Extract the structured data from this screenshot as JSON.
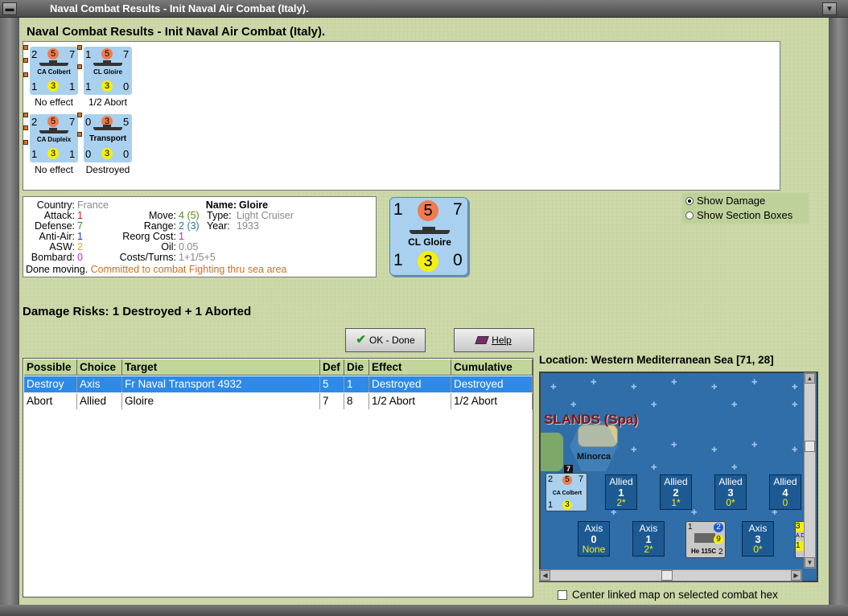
{
  "window": {
    "title": "Naval Combat Results - Init Naval Air Combat (Italy)."
  },
  "heading": "Naval Combat Results - Init Naval Air Combat (Italy).",
  "results": [
    {
      "name": "CA Colbert",
      "left": "2",
      "att": "5",
      "right": "7",
      "bl": "1",
      "def": "3",
      "br": "1",
      "effect": "No effect"
    },
    {
      "name": "CL Gloire",
      "left": "1",
      "att": "5",
      "right": "7",
      "bl": "1",
      "def": "3",
      "br": "0",
      "effect": "1/2 Abort"
    },
    {
      "name": "CA Dupleix",
      "left": "2",
      "att": "5",
      "right": "7",
      "bl": "1",
      "def": "3",
      "br": "1",
      "effect": "No effect"
    },
    {
      "name": "Transport",
      "left": "0",
      "att": "3",
      "right": "5",
      "bl": "0",
      "def": "3",
      "br": "0",
      "effect": "Destroyed"
    }
  ],
  "info": {
    "country_label": "Country:",
    "country": "France",
    "attack_label": "Attack:",
    "attack": "1",
    "defense_label": "Defense:",
    "defense": "7",
    "antiair_label": "Anti-Air:",
    "antiair": "1",
    "asw_label": "ASW:",
    "asw": "2",
    "bombard_label": "Bombard:",
    "bombard": "0",
    "name_label": "Name:",
    "name": "Gloire",
    "move_label": "Move:",
    "move": "4",
    "move_paren": "(5)",
    "type_label": "Type:",
    "type": "Light Cruiser",
    "range_label": "Range:",
    "range": "2",
    "range_paren": "(3)",
    "year_label": "Year:",
    "year": "1933",
    "reorg_label": "Reorg Cost:",
    "reorg": "1",
    "oil_label": "Oil:",
    "oil": "0.05",
    "costs_label": "Costs/Turns:",
    "costs": "1+1/5+5",
    "status": "Done moving.",
    "status_detail": "Committed to combat Fighting thru sea area"
  },
  "big_counter": {
    "name": "CL Gloire",
    "left": "1",
    "att": "5",
    "right": "7",
    "bl": "1",
    "def": "3",
    "br": "0"
  },
  "display_options": {
    "show_damage": "Show Damage",
    "show_section": "Show Section Boxes"
  },
  "damage_risks": "Damage Risks:  1 Destroyed + 1 Aborted",
  "buttons": {
    "ok": "OK - Done",
    "help": "Help"
  },
  "table": {
    "headers": [
      "Possible",
      "Choice",
      "Target",
      "Def",
      "Die",
      "Effect",
      "Cumulative"
    ],
    "rows": [
      [
        "Destroy",
        "Axis",
        "Fr Naval Transport 4932",
        "5",
        "1",
        "Destroyed",
        "Destroyed"
      ],
      [
        "Abort",
        "Allied",
        "Gloire",
        "7",
        "8",
        "1/2 Abort",
        "1/2 Abort"
      ]
    ]
  },
  "location": "Location:  Western Mediterranean Sea [71, 28]",
  "map": {
    "hex_label": "SLANDS (Spa)",
    "island": "Minorca",
    "stack_count": "7",
    "map_counter": {
      "name": "CA Colbert",
      "left": "2",
      "att": "5",
      "right": "7",
      "bl": "1",
      "def": "3"
    },
    "allied": [
      {
        "side": "Allied",
        "num": "1",
        "val": "2*"
      },
      {
        "side": "Allied",
        "num": "2",
        "val": "1*"
      },
      {
        "side": "Allied",
        "num": "3",
        "val": "0*"
      },
      {
        "side": "Allied",
        "num": "4",
        "val": "0"
      }
    ],
    "axis": [
      {
        "side": "Axis",
        "num": "0",
        "val": "None"
      },
      {
        "side": "Axis",
        "num": "1",
        "val": "2*"
      },
      {
        "side": "Axis",
        "num": "3",
        "val": "0*"
      }
    ],
    "air_counter": {
      "name": "He 115C",
      "left": "1",
      "att": "2",
      "def": "9",
      "br": "2"
    },
    "edge_counter": {
      "top": "3",
      "bot": "1",
      "txt": "A D"
    }
  },
  "center_linked": "Center linked map on selected combat hex"
}
